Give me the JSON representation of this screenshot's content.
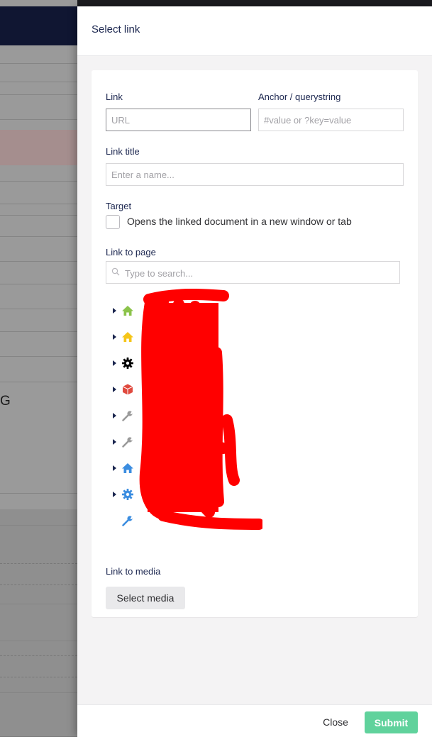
{
  "background": {
    "letter": "G"
  },
  "dialog": {
    "title": "Select link",
    "link": {
      "label": "Link",
      "value": "",
      "placeholder": "URL"
    },
    "anchor": {
      "label": "Anchor / querystring",
      "value": "",
      "placeholder": "#value or ?key=value"
    },
    "link_title": {
      "label": "Link title",
      "value": "",
      "placeholder": "Enter a name..."
    },
    "target": {
      "label": "Target",
      "checkbox_text": "Opens the linked document in a new window or tab",
      "checked": false
    },
    "link_to_page": {
      "label": "Link to page",
      "search_placeholder": "Type to search..."
    },
    "tree": [
      {
        "icon": "home-icon",
        "color": "#8bc34a",
        "expandable": true,
        "label": ""
      },
      {
        "icon": "home-icon",
        "color": "#f5c518",
        "expandable": true,
        "label": ""
      },
      {
        "icon": "gear-icon",
        "color": "#000000",
        "expandable": true,
        "label": ""
      },
      {
        "icon": "box-icon",
        "color": "#e04a3f",
        "expandable": true,
        "label": ""
      },
      {
        "icon": "wrench-icon",
        "color": "#9a9a9a",
        "expandable": true,
        "label": ""
      },
      {
        "icon": "wrench-icon",
        "color": "#9a9a9a",
        "expandable": true,
        "label": ""
      },
      {
        "icon": "home-icon",
        "color": "#3b8de0",
        "expandable": true,
        "label": ""
      },
      {
        "icon": "gear-icon",
        "color": "#3b8de0",
        "expandable": true,
        "label": ""
      },
      {
        "icon": "wrench-icon",
        "color": "#3b8de0",
        "expandable": false,
        "label": ""
      }
    ],
    "link_to_media": {
      "label": "Link to media",
      "button": "Select media"
    },
    "footer": {
      "close": "Close",
      "submit": "Submit"
    }
  },
  "colors": {
    "redaction": "#ff0000",
    "submit": "#2bc37c",
    "header_bg": "#101632"
  }
}
